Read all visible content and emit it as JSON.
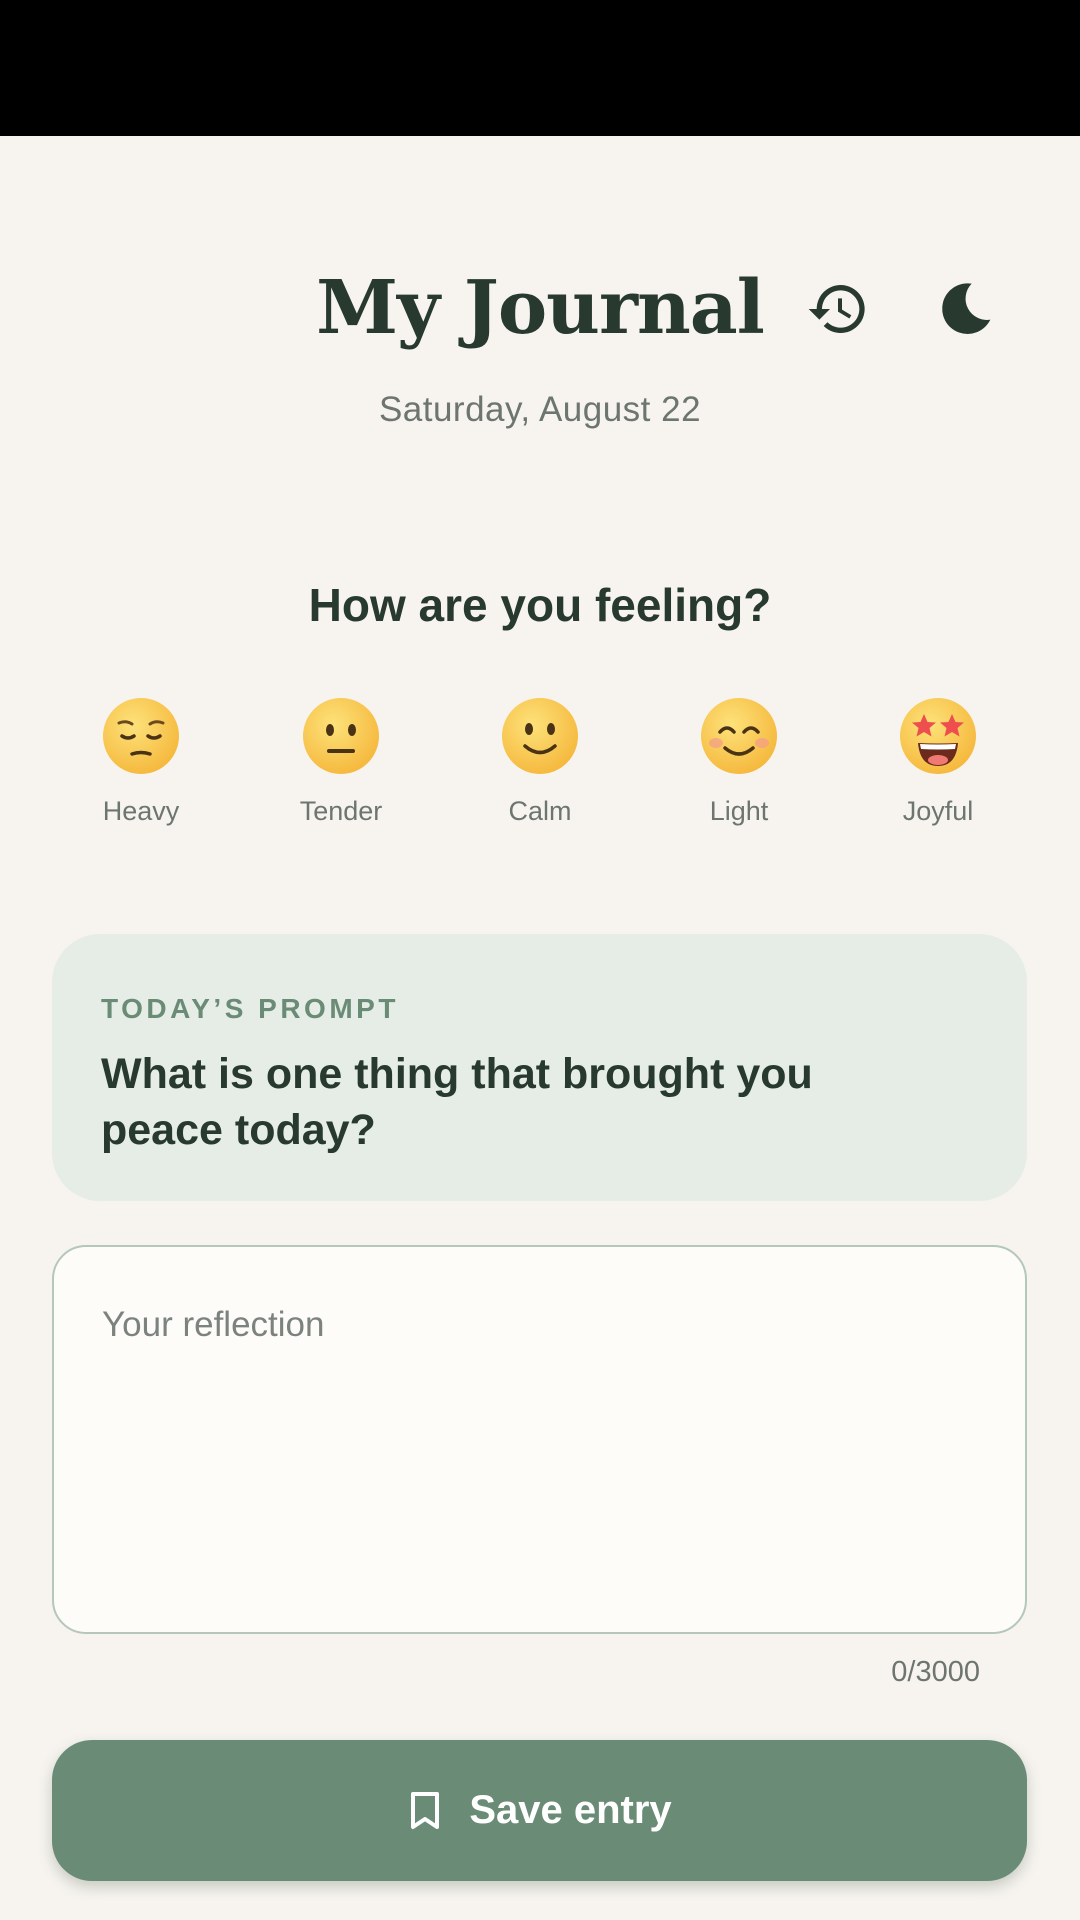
{
  "header": {
    "title": "My Journal",
    "date": "Saturday, August 22",
    "history_icon": "history-icon",
    "theme_icon": "moon-icon"
  },
  "mood": {
    "heading": "How are you feeling?",
    "options": [
      {
        "label": "Heavy",
        "icon": "pensive-face-emoji"
      },
      {
        "label": "Tender",
        "icon": "neutral-face-emoji"
      },
      {
        "label": "Calm",
        "icon": "slightly-smiling-face-emoji"
      },
      {
        "label": "Light",
        "icon": "smiling-face-with-blush-emoji"
      },
      {
        "label": "Joyful",
        "icon": "star-struck-face-emoji"
      }
    ]
  },
  "prompt": {
    "kicker": "TODAY’S PROMPT",
    "question": "What is one thing that brought you peace today?"
  },
  "reflection": {
    "placeholder": "Your reflection",
    "value": "",
    "counter": "0/3000"
  },
  "save": {
    "label": "Save entry",
    "icon": "bookmark-icon"
  },
  "colors": {
    "background": "#f7f4ef",
    "text_dark": "#283a2f",
    "text_muted": "#6d7570",
    "accent_green": "#6a8c77",
    "prompt_card_bg": "#e6ede6",
    "field_border": "#b5c7ba",
    "status_bar": "#000000"
  }
}
